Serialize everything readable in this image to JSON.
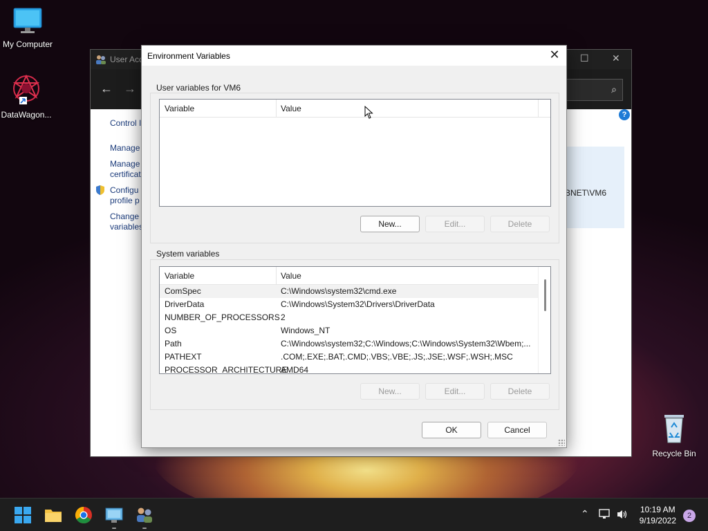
{
  "desktop": {
    "icons": [
      {
        "label": "My Computer",
        "icon": "monitor-icon"
      },
      {
        "label": "DataWagon...",
        "icon": "app-shortcut-icon"
      },
      {
        "label": "Recycle Bin",
        "icon": "recycle-bin-icon"
      }
    ]
  },
  "background_window": {
    "title": "User Acc",
    "left_items": [
      "Control I",
      "Manage",
      "Manage certificat",
      "Configu profile p",
      "Change variables"
    ],
    "user_text": "BNET\\VM6"
  },
  "dialog": {
    "title": "Environment Variables",
    "user_group_label": "User variables for VM6",
    "system_group_label": "System variables",
    "columns": [
      "Variable",
      "Value"
    ],
    "user_vars": [],
    "system_vars": [
      {
        "name": "ComSpec",
        "value": "C:\\Windows\\system32\\cmd.exe"
      },
      {
        "name": "DriverData",
        "value": "C:\\Windows\\System32\\Drivers\\DriverData"
      },
      {
        "name": "NUMBER_OF_PROCESSORS",
        "value": "2"
      },
      {
        "name": "OS",
        "value": "Windows_NT"
      },
      {
        "name": "Path",
        "value": "C:\\Windows\\system32;C:\\Windows;C:\\Windows\\System32\\Wbem;..."
      },
      {
        "name": "PATHEXT",
        "value": ".COM;.EXE;.BAT;.CMD;.VBS;.VBE;.JS;.JSE;.WSF;.WSH;.MSC"
      },
      {
        "name": "PROCESSOR_ARCHITECTURE",
        "value": "AMD64"
      }
    ],
    "user_buttons": {
      "new": "New...",
      "edit": "Edit...",
      "delete": "Delete"
    },
    "system_buttons": {
      "new": "New...",
      "edit": "Edit...",
      "delete": "Delete"
    },
    "ok": "OK",
    "cancel": "Cancel",
    "close_glyph": "✕"
  },
  "taskbar": {
    "time": "10:19 AM",
    "date": "9/19/2022",
    "notification_count": "2"
  }
}
